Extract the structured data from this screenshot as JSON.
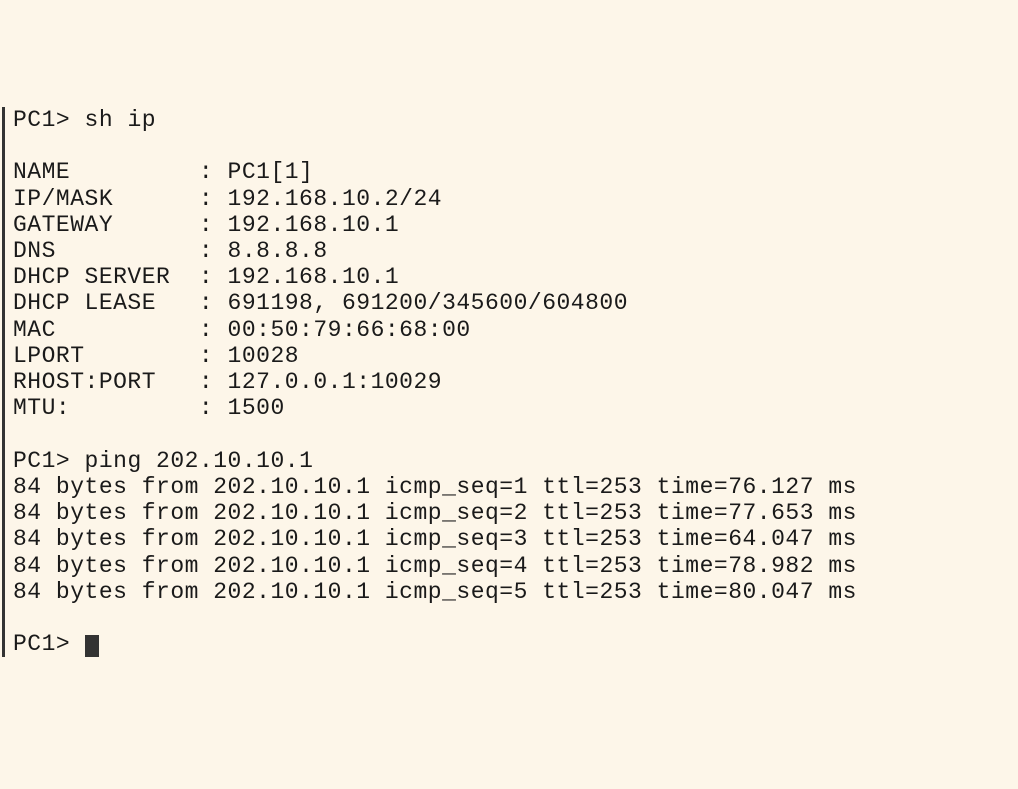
{
  "prompt": "PC1>",
  "cmd1": "sh ip",
  "config": {
    "rows": [
      {
        "label": "NAME       ",
        "value": "PC1[1]"
      },
      {
        "label": "IP/MASK    ",
        "value": "192.168.10.2/24"
      },
      {
        "label": "GATEWAY    ",
        "value": "192.168.10.1"
      },
      {
        "label": "DNS        ",
        "value": "8.8.8.8"
      },
      {
        "label": "DHCP SERVER",
        "value": "192.168.10.1"
      },
      {
        "label": "DHCP LEASE ",
        "value": "691198, 691200/345600/604800"
      },
      {
        "label": "MAC        ",
        "value": "00:50:79:66:68:00"
      },
      {
        "label": "LPORT      ",
        "value": "10028"
      },
      {
        "label": "RHOST:PORT ",
        "value": "127.0.0.1:10029"
      },
      {
        "label": "MTU:       ",
        "value": "1500"
      }
    ]
  },
  "cmd2": "ping 202.10.10.1",
  "ping": {
    "bytes": "84",
    "from": "202.10.10.1",
    "ttl": "253",
    "replies": [
      {
        "seq": "1",
        "time": "76.127"
      },
      {
        "seq": "2",
        "time": "77.653"
      },
      {
        "seq": "3",
        "time": "64.047"
      },
      {
        "seq": "4",
        "time": "78.982"
      },
      {
        "seq": "5",
        "time": "80.047"
      }
    ]
  }
}
